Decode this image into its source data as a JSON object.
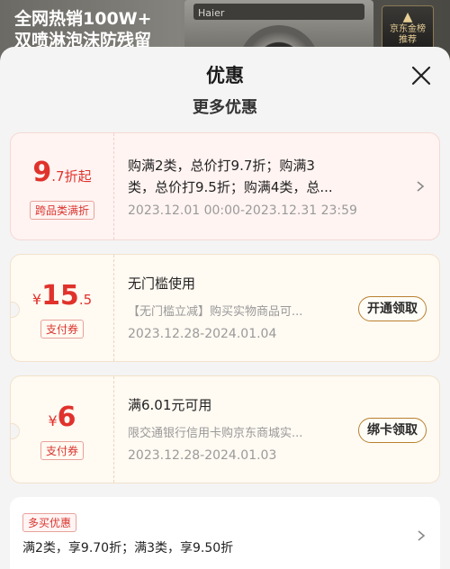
{
  "banner": {
    "line1": "全网热销100W+",
    "line2": "双喷淋泡沫防残留",
    "brand": "Haier",
    "award_line1": "京东金榜",
    "award_line2": "推荐"
  },
  "sheet": {
    "title": "优惠",
    "section_title": "更多优惠"
  },
  "coupons": [
    {
      "amount_big": "9",
      "amount_small": ".7折起",
      "tag": "跨品类满折",
      "desc_line1": "购满2类，总价打9.7折；购满3",
      "desc_line2": "类，总价打9.5折；购满4类，总...",
      "date": "2023.12.01 00:00-2023.12.31 23:59",
      "action": ""
    },
    {
      "currency": "¥",
      "amount_big": "15",
      "amount_small": ".5",
      "tag": "支付券",
      "desc_line1": "无门槛使用",
      "desc_line2": "【无门槛立减】购买实物商品可...",
      "date": "2023.12.28-2024.01.04",
      "action": "开通领取"
    },
    {
      "currency": "¥",
      "amount_big": "6",
      "amount_small": "",
      "tag": "支付券",
      "desc_line1": "满6.01元可用",
      "desc_line2": "限交通银行信用卡购京东商城实...",
      "date": "2023.12.28-2024.01.03",
      "action": "绑卡领取"
    }
  ],
  "multi_buy": {
    "tag": "多买优惠",
    "text": "满2类，享9.70折；满3类，享9.50折"
  },
  "colors": {
    "accent_red": "#e0322c",
    "button_border": "#b9802f"
  }
}
